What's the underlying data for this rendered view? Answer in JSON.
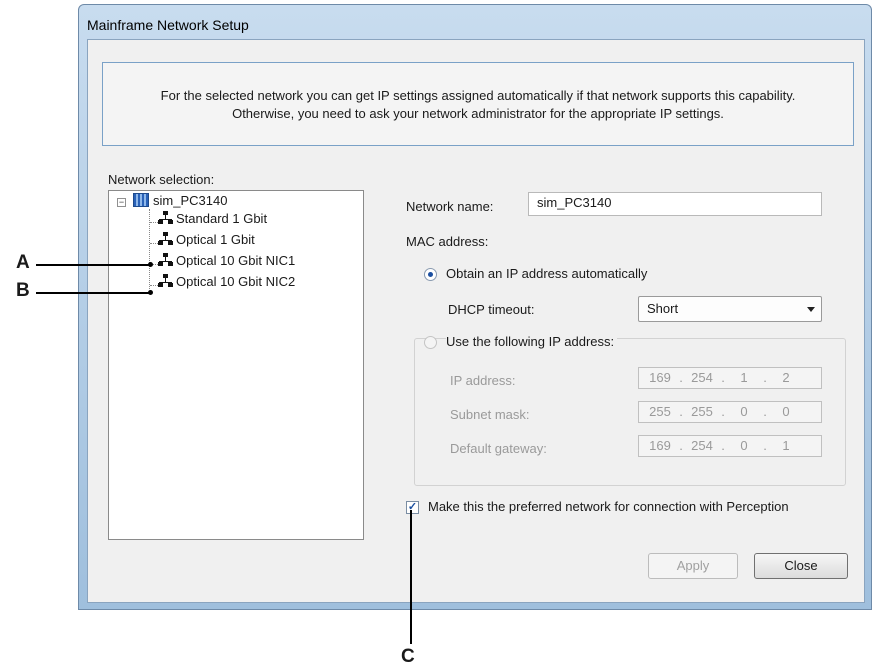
{
  "window": {
    "title": "Mainframe Network Setup"
  },
  "info": {
    "line1": "For the selected network you can get IP settings assigned automatically if that network supports this capability.",
    "line2": "Otherwise, you need to ask your network administrator for the appropriate IP settings."
  },
  "tree": {
    "label": "Network selection:",
    "root": {
      "label": "sim_PC3140",
      "icon": "computer-icon",
      "expander": "−"
    },
    "items": [
      {
        "label": "Standard 1 Gbit",
        "icon": "network-icon"
      },
      {
        "label": "Optical 1 Gbit",
        "icon": "network-icon"
      },
      {
        "label": "Optical 10 Gbit NIC1",
        "icon": "network-icon"
      },
      {
        "label": "Optical 10 Gbit NIC2",
        "icon": "network-icon"
      }
    ]
  },
  "settings": {
    "network_name_label": "Network name:",
    "network_name_value": "sim_PC3140",
    "mac_label": "MAC address:",
    "obtain_auto_label": "Obtain an IP address automatically",
    "dhcp_label": "DHCP timeout:",
    "dhcp_value": "Short",
    "use_following_label": "Use the following IP address:",
    "ip_label": "IP address:",
    "ip": [
      "169",
      "254",
      "1",
      "2"
    ],
    "subnet_label": "Subnet mask:",
    "subnet": [
      "255",
      "255",
      "0",
      "0"
    ],
    "gateway_label": "Default gateway:",
    "gateway": [
      "169",
      "254",
      "0",
      "1"
    ],
    "dot": ".",
    "preferred_label": "Make this the preferred network for connection with Perception",
    "preferred_checked": true,
    "obtain_auto_selected": true
  },
  "buttons": {
    "apply": "Apply",
    "close": "Close"
  },
  "callouts": {
    "a": "A",
    "b": "B",
    "c": "C"
  },
  "colors": {
    "accent": "#1b4fa0",
    "frame": "#9fbfdd"
  }
}
